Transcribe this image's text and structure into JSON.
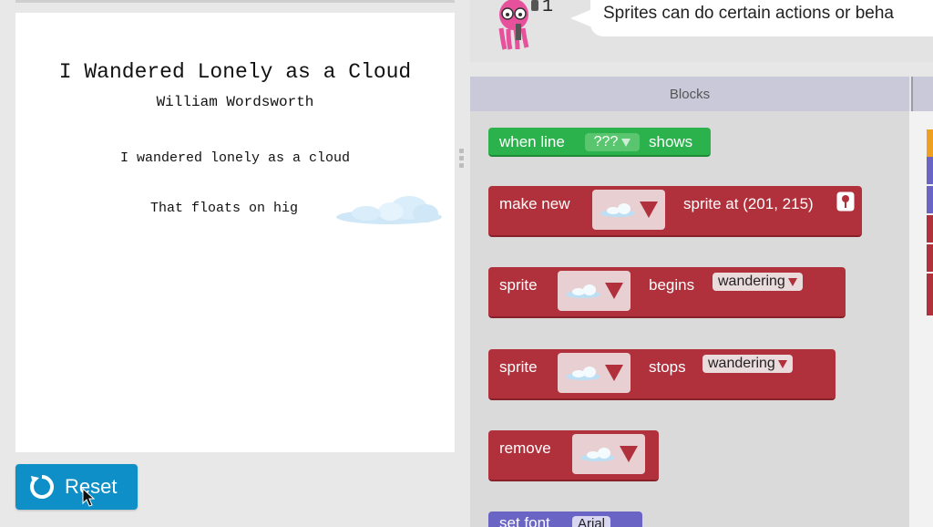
{
  "stage": {
    "title": "I Wandered Lonely as a Cloud",
    "author": "William Wordsworth",
    "line1": "I wandered lonely as a cloud",
    "line2": "That floats on hig"
  },
  "reset": {
    "label": "Reset"
  },
  "instructions": {
    "hint_number": "1",
    "text": "Sprites can do certain actions or beha"
  },
  "blocks": {
    "header": "Blocks",
    "when_line": {
      "prefix": "when line",
      "value": "???",
      "suffix": "shows"
    },
    "make_new": {
      "prefix": "make new",
      "suffix": "sprite at (201, 215)"
    },
    "sprite_begins": {
      "prefix": "sprite",
      "middle": "begins",
      "value": "wandering"
    },
    "sprite_stops": {
      "prefix": "sprite",
      "middle": "stops",
      "value": "wandering"
    },
    "remove": {
      "label": "remove"
    },
    "set_font": {
      "label": "set font",
      "value": "Arial"
    }
  },
  "colors": {
    "event_green": "#2bb24c",
    "sprite_red": "#b0313c",
    "text_purple": "#6a64c4",
    "reset_blue": "#0f8fc8"
  },
  "icons": [
    "reset-icon",
    "cloud-sprite-icon",
    "dropdown-arrow-icon",
    "location-pin-icon",
    "octopus-avatar-icon",
    "mouse-cursor-icon"
  ]
}
